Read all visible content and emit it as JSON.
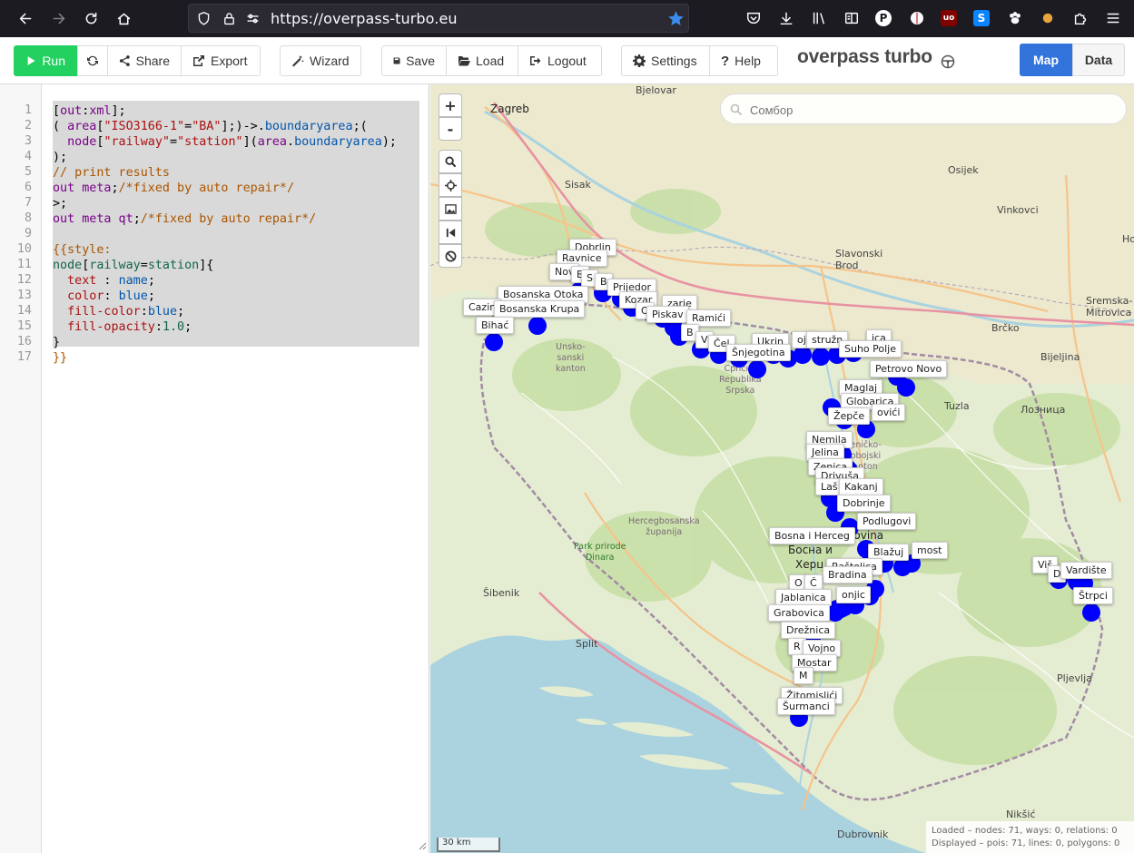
{
  "browser": {
    "url": "https://overpass-turbo.eu",
    "profile_letter": "P",
    "ublock_label": "uo",
    "ext_s": "S"
  },
  "toolbar": {
    "run": "Run",
    "share": "Share",
    "export": "Export",
    "wizard": "Wizard",
    "save": "Save",
    "load": "Load",
    "logout": "Logout",
    "settings": "Settings",
    "help": "Help",
    "brand": "overpass turbo",
    "tab_map": "Map",
    "tab_data": "Data"
  },
  "editor": {
    "line_numbers": [
      "1",
      "2",
      "3",
      "4",
      "5",
      "6",
      "7",
      "8",
      "9",
      "10",
      "11",
      "12",
      "13",
      "14",
      "15",
      "16",
      "17"
    ],
    "lines": [
      [
        [
          "b",
          "["
        ],
        [
          "k",
          "out"
        ],
        [
          "b",
          ":"
        ],
        [
          "k",
          "xml"
        ],
        [
          "b",
          "];"
        ]
      ],
      [
        [
          "b",
          "( "
        ],
        [
          "k",
          "area"
        ],
        [
          "b",
          "["
        ],
        [
          "s",
          "\"ISO3166-1\""
        ],
        [
          "b",
          "="
        ],
        [
          "s",
          "\"BA\""
        ],
        [
          "b",
          "];)->."
        ],
        [
          "v",
          "boundaryarea"
        ],
        [
          "b",
          ";("
        ]
      ],
      [
        [
          "b",
          "  "
        ],
        [
          "k",
          "node"
        ],
        [
          "b",
          "["
        ],
        [
          "s",
          "\"railway\""
        ],
        [
          "b",
          "="
        ],
        [
          "s",
          "\"station\""
        ],
        [
          "b",
          "]("
        ],
        [
          "k",
          "area"
        ],
        [
          "b",
          "."
        ],
        [
          "v",
          "boundaryarea"
        ],
        [
          "b",
          ");"
        ]
      ],
      [
        [
          "b",
          ");"
        ]
      ],
      [
        [
          "c",
          "// print results"
        ]
      ],
      [
        [
          "k",
          "out meta"
        ],
        [
          "b",
          ";"
        ],
        [
          "c",
          "/*fixed by auto repair*/"
        ]
      ],
      [
        [
          "b",
          ">;"
        ]
      ],
      [
        [
          "k",
          "out meta qt"
        ],
        [
          "b",
          ";"
        ],
        [
          "c",
          "/*fixed by auto repair*/"
        ]
      ],
      [
        [
          "b",
          ""
        ]
      ],
      [
        [
          "g",
          "{{style:"
        ]
      ],
      [
        [
          "d",
          "node"
        ],
        [
          "b",
          "["
        ],
        [
          "d",
          "railway"
        ],
        [
          "b",
          "="
        ],
        [
          "d",
          "station"
        ],
        [
          "b",
          "]{"
        ]
      ],
      [
        [
          "b",
          "  "
        ],
        [
          "s",
          "text"
        ],
        [
          "b",
          " : "
        ],
        [
          "v",
          "name"
        ],
        [
          "b",
          ";"
        ]
      ],
      [
        [
          "b",
          "  "
        ],
        [
          "s",
          "color"
        ],
        [
          "b",
          ": "
        ],
        [
          "v",
          "blue"
        ],
        [
          "b",
          ";"
        ]
      ],
      [
        [
          "b",
          "  "
        ],
        [
          "s",
          "fill-color"
        ],
        [
          "b",
          ":"
        ],
        [
          "v",
          "blue"
        ],
        [
          "b",
          ";"
        ]
      ],
      [
        [
          "b",
          "  "
        ],
        [
          "s",
          "fill-opacity"
        ],
        [
          "b",
          ":"
        ],
        [
          "d",
          "1.0"
        ],
        [
          "b",
          ";"
        ]
      ],
      [
        [
          "b",
          "}"
        ]
      ],
      [
        [
          "g",
          "}}"
        ]
      ]
    ]
  },
  "map": {
    "search_placeholder": "Сомбор",
    "zoom_in": "+",
    "zoom_out": "-",
    "scale": "30 km",
    "status_line1": "Loaded – nodes: 71, ways: 0, relations: 0",
    "status_line2": "Displayed – pois: 71, lines: 0, polygons: 0",
    "place_names": [
      {
        "t": "Zagreb",
        "big": true
      },
      {
        "t": "Bjelovar"
      },
      {
        "t": "Sisak"
      },
      {
        "t": "Osijek"
      },
      {
        "t": "Vinkovci"
      },
      {
        "t": "Slavonski\nBrod"
      },
      {
        "t": "Brčko"
      },
      {
        "t": "Bijeljina"
      },
      {
        "t": "Sremska-\nMitrovica"
      },
      {
        "t": "Tuzla"
      },
      {
        "t": "Лозница"
      },
      {
        "t": "Šibenik"
      },
      {
        "t": "Split"
      },
      {
        "t": "Pljevlja"
      },
      {
        "t": "Nikšić"
      },
      {
        "t": "Dubrovnik"
      },
      {
        "t": "Bosna i Hercegovina",
        "big": true
      },
      {
        "t": "Босна и",
        "big": true
      },
      {
        "t": "Херц",
        "big": true
      },
      {
        "t": "Ho"
      }
    ],
    "region_names": [
      {
        "t": "Unsko-\nsanski\nkanton"
      },
      {
        "t": "Hercegbosanska\nžupanija"
      },
      {
        "t": "Zeničko-\ndobojski\nkanton"
      },
      {
        "t": "Српска\nRepublika\nSrpska"
      }
    ],
    "park_names": [
      {
        "t": "Park prirode\nDinara"
      }
    ],
    "stations": [
      {
        "t": "Dobrlin"
      },
      {
        "t": "Ravnice"
      },
      {
        "t": "Nov"
      },
      {
        "t": "B"
      },
      {
        "t": "S"
      },
      {
        "t": "B"
      },
      {
        "t": "Prijedor"
      },
      {
        "t": "Bosanska Otoka"
      },
      {
        "t": "Kozar"
      },
      {
        "t": "Cazin"
      },
      {
        "t": "Bosanska Krupa"
      },
      {
        "t": "O"
      },
      {
        "t": "zarje"
      },
      {
        "t": "Piskav"
      },
      {
        "t": "Ramići"
      },
      {
        "t": "Bihać"
      },
      {
        "t": "B"
      },
      {
        "t": "V"
      },
      {
        "t": "Čel"
      },
      {
        "t": "Ukrin"
      },
      {
        "t": "oje"
      },
      {
        "t": "Šnjegotina"
      },
      {
        "t": "stružn"
      },
      {
        "t": "ica"
      },
      {
        "t": "Suho Polje"
      },
      {
        "t": "Petrovo Novo"
      },
      {
        "t": "Maglaj"
      },
      {
        "t": "Globarica"
      },
      {
        "t": "ovići"
      },
      {
        "t": "Žepče"
      },
      {
        "t": "Nemila"
      },
      {
        "t": "Jelina"
      },
      {
        "t": "Zenica"
      },
      {
        "t": "Drivuša"
      },
      {
        "t": "Laš"
      },
      {
        "t": "Kakanj"
      },
      {
        "t": "Dobrinje"
      },
      {
        "t": "Podlugovi"
      },
      {
        "t": "Bosna i Herceg"
      },
      {
        "t": "Blažuj"
      },
      {
        "t": "most"
      },
      {
        "t": "Raštelica"
      },
      {
        "t": "Bradina"
      },
      {
        "t": "O"
      },
      {
        "t": "Č"
      },
      {
        "t": "onjic"
      },
      {
        "t": "Jablanica"
      },
      {
        "t": "Grabovica"
      },
      {
        "t": "Drežnica"
      },
      {
        "t": "R"
      },
      {
        "t": "Vojno"
      },
      {
        "t": "Mostar"
      },
      {
        "t": "M"
      },
      {
        "t": "Žitomislići"
      },
      {
        "t": "Šurmanci"
      },
      {
        "t": "Viš"
      },
      {
        "t": "D"
      },
      {
        "t": "Vardište"
      },
      {
        "t": "Štrpci"
      }
    ]
  }
}
